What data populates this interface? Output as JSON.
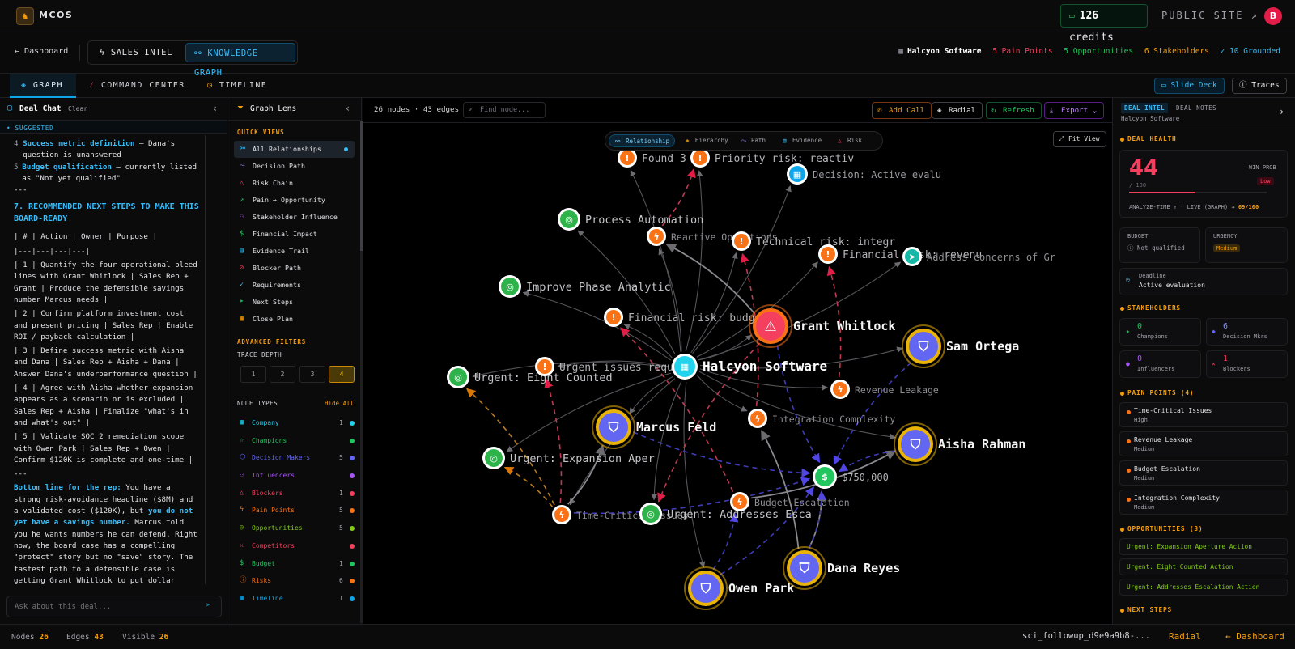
{
  "topbar": {
    "brand": "MCOS",
    "credits_count": "126",
    "credits_label": "credits",
    "public_site": "PUBLIC SITE ↗",
    "avatar": "B"
  },
  "subbar": {
    "back": "Dashboard",
    "mode_sales": "SALES INTEL",
    "mode_kg": "KNOWLEDGE GRAPH",
    "company": "Halcyon Software",
    "pain_points": "5 Pain Points",
    "opportunities": "5 Opportunities",
    "stakeholders": "6 Stakeholders",
    "grounded": "✓ 10 Grounded"
  },
  "tabs": {
    "graph": "GRAPH",
    "command_center": "COMMAND CENTER",
    "timeline": "TIMELINE",
    "slide_deck": "Slide Deck",
    "traces": "Traces"
  },
  "chat": {
    "title": "Deal Chat",
    "clear": "Clear",
    "suggested": "• SUGGESTED",
    "item4_num": "4",
    "item4_bold": "Success metric definition",
    "item4_rest": " — Dana's question is unanswered",
    "item5_num": "5",
    "item5_bold": "Budget qualification",
    "item5_rest": " — currently listed as \"Not yet qualified\"",
    "sep1": "---",
    "section7": "7. RECOMMENDED NEXT STEPS TO MAKE THIS BOARD-READY",
    "table_header": "| # | Action | Owner | Purpose |",
    "table_sep": "|---|---|---|---|",
    "row1": "| 1 | Quantify the four operational bleed lines with Grant Whitlock | Sales Rep + Grant | Produce the defensible savings number Marcus needs |",
    "row2": "| 2 | Confirm platform investment cost and present pricing | Sales Rep | Enable ROI / payback calculation |",
    "row3": "| 3 | Define success metric with Aisha and Dana | Sales Rep + Aisha + Dana | Answer Dana's underperformance question |",
    "row4": "| 4 | Agree with Aisha whether expansion appears as a scenario or is excluded | Sales Rep + Aisha | Finalize \"what's in and what's out\" |",
    "row5": "| 5 | Validate SOC 2 remediation scope with Owen Park | Sales Rep + Owen | Confirm $120K is complete and one-time |",
    "sep2": "---",
    "bottom_bold": "Bottom line for the rep:",
    "bottom_a": " You have a strong risk-avoidance headline ($8M) and a validated cost ($120K), but ",
    "bottom_hl": "you do not yet have a savings number.",
    "bottom_b": " Marcus told you he wants numbers he can defend. Right now, the board case has a compelling \"protect\" story but no \"save\" story. The fastest path to a defensible case is getting Grant Whitlock to put dollar",
    "input_placeholder": "Ask about this deal..."
  },
  "lens": {
    "title": "Graph Lens",
    "quick_views_title": "QUICK VIEWS",
    "quick_views": [
      "All Relationships",
      "Decision Path",
      "Risk Chain",
      "Pain → Opportunity",
      "Stakeholder Influence",
      "Financial Impact",
      "Evidence Trail",
      "Blocker Path",
      "Requirements",
      "Next Steps",
      "Close Plan"
    ],
    "advanced_title": "ADVANCED FILTERS",
    "trace_depth": "TRACE DEPTH",
    "depths": [
      "1",
      "2",
      "3",
      "4"
    ],
    "node_types_title": "NODE TYPES",
    "hide_all": "Hide All",
    "node_types": [
      {
        "label": "Company",
        "count": "1",
        "color": "#22d3ee"
      },
      {
        "label": "Champions",
        "count": "",
        "color": "#22c55e"
      },
      {
        "label": "Decision Makers",
        "count": "5",
        "color": "#6366f1"
      },
      {
        "label": "Influencers",
        "count": "",
        "color": "#a855f7"
      },
      {
        "label": "Blockers",
        "count": "1",
        "color": "#f43f5e"
      },
      {
        "label": "Pain Points",
        "count": "5",
        "color": "#f97316"
      },
      {
        "label": "Opportunities",
        "count": "5",
        "color": "#84cc16"
      },
      {
        "label": "Competitors",
        "count": "",
        "color": "#f43f5e"
      },
      {
        "label": "Budget",
        "count": "1",
        "color": "#22c55e"
      },
      {
        "label": "Risks",
        "count": "6",
        "color": "#f97316"
      },
      {
        "label": "Timeline",
        "count": "1",
        "color": "#0ea5e9"
      }
    ]
  },
  "graph": {
    "stats": "26 nodes · 43 edges",
    "search_placeholder": "Find node...",
    "add_call": "Add Call",
    "radial": "Radial",
    "refresh": "Refresh",
    "export": "Export",
    "lens_tabs": [
      "Relationship",
      "Hierarchy",
      "Path",
      "Evidence",
      "Risk"
    ],
    "fit_view": "Fit View"
  },
  "insights": {
    "tab_intel": "DEAL INTEL",
    "tab_notes": "DEAL NOTES",
    "company": "Halcyon Software",
    "deal_health": "DEAL HEALTH",
    "score": "44",
    "score_max": "/ 100",
    "score_fraction": 0.48,
    "win_prob": "WIN PROB",
    "win_value": "Low",
    "analyze": "ANALYZE-TIME ↑ · LIVE (GRAPH) →",
    "analyze_value": "69/100",
    "budget_label": "BUDGET",
    "budget_value": "Not qualified",
    "urgency_label": "URGENCY",
    "urgency_value": "Medium",
    "deadline_label": "Deadline",
    "deadline_value": "Active evaluation",
    "stakeholders_title": "STAKEHOLDERS",
    "champions_n": "0",
    "champions_l": "Champions",
    "decision_n": "6",
    "decision_l": "Decision Mkrs",
    "influencers_n": "0",
    "influencers_l": "Influencers",
    "blockers_n": "1",
    "blockers_l": "Blockers",
    "pain_points_title": "PAIN POINTS (4)",
    "pain_points": [
      {
        "title": "Time-Critical Issues",
        "level": "High"
      },
      {
        "title": "Revenue Leakage",
        "level": "Medium"
      },
      {
        "title": "Budget Escalation",
        "level": "Medium"
      },
      {
        "title": "Integration Complexity",
        "level": "Medium"
      }
    ],
    "opportunities_title": "OPPORTUNITIES (3)",
    "opportunities": [
      "Urgent: Expansion Aperture Action",
      "Urgent: Eight Counted Action",
      "Urgent: Addresses Escalation Action"
    ],
    "next_steps_title": "NEXT STEPS"
  },
  "status": {
    "nodes_l": "Nodes",
    "nodes_v": "26",
    "edges_l": "Edges",
    "edges_v": "43",
    "visible_l": "Visible",
    "visible_v": "26",
    "trace_id": "sci_followup_d9e9a9b8-...",
    "radial": "Radial",
    "dashboard": "← Dashboard"
  },
  "colors": {
    "accent": "#38bdf8",
    "amber": "#f59e0b",
    "risk": "#f97316",
    "opportunity": "#84cc16",
    "stakeholder": "#6366f1",
    "company": "#22d3ee",
    "budget": "#22c55e",
    "blocker": "#f43f5e",
    "timeline": "#0ea5e9"
  },
  "graph_nodes": [
    {
      "id": "found",
      "type": "risk",
      "label": "Found 3 u"
    },
    {
      "id": "priority",
      "type": "risk",
      "label": "Priority risk: reactiv"
    },
    {
      "id": "decision",
      "type": "timeline",
      "label": "Decision: Active evalu"
    },
    {
      "id": "process",
      "type": "opportunity",
      "label": "Process Automation"
    },
    {
      "id": "reactive",
      "type": "pain",
      "label": "Reactive Operations"
    },
    {
      "id": "technical",
      "type": "risk",
      "label": "Technical risk: integr"
    },
    {
      "id": "financial1",
      "type": "risk",
      "label": "Financial risk: revenu"
    },
    {
      "id": "address",
      "type": "next",
      "label": "Address concerns of Gr"
    },
    {
      "id": "improve",
      "type": "opportunity",
      "label": "Improve Phase Analytic"
    },
    {
      "id": "financial2",
      "type": "risk",
      "label": "Financial risk: budget"
    },
    {
      "id": "grant",
      "type": "blocker",
      "label": "Grant Whitlock"
    },
    {
      "id": "sam",
      "type": "stakeholder",
      "label": "Sam Ortega"
    },
    {
      "id": "urgent_eight",
      "type": "opportunity",
      "label": "Urgent: Eight Counted"
    },
    {
      "id": "urgent_issues",
      "type": "risk",
      "label": "Urgent issues require"
    },
    {
      "id": "halcyon",
      "type": "company",
      "label": "Halcyon Software"
    },
    {
      "id": "revenue",
      "type": "pain",
      "label": "Revenue Leakage"
    },
    {
      "id": "marcus",
      "type": "stakeholder",
      "label": "Marcus Feld"
    },
    {
      "id": "integration",
      "type": "pain",
      "label": "Integration Complexity"
    },
    {
      "id": "aisha",
      "type": "stakeholder",
      "label": "Aisha Rahman"
    },
    {
      "id": "expansion",
      "type": "opportunity",
      "label": "Urgent: Expansion Aper"
    },
    {
      "id": "budget",
      "type": "budget",
      "label": "$750,000"
    },
    {
      "id": "time",
      "type": "pain",
      "label": "Time-Critical Issues"
    },
    {
      "id": "addresses",
      "type": "opportunity",
      "label": "Urgent: Addresses Esca"
    },
    {
      "id": "budgetesc",
      "type": "pain",
      "label": "Budget Escalation"
    },
    {
      "id": "dana",
      "type": "stakeholder",
      "label": "Dana Reyes"
    },
    {
      "id": "owen",
      "type": "stakeholder",
      "label": "Owen Park"
    }
  ],
  "graph_edges": [
    [
      "halcyon",
      "process",
      "solid"
    ],
    [
      "halcyon",
      "improve",
      "solid"
    ],
    [
      "halcyon",
      "reactive",
      "solid"
    ],
    [
      "halcyon",
      "found",
      "solid"
    ],
    [
      "halcyon",
      "priority",
      "solid"
    ],
    [
      "halcyon",
      "decision",
      "solid"
    ],
    [
      "halcyon",
      "technical",
      "solid"
    ],
    [
      "halcyon",
      "financial1",
      "solid"
    ],
    [
      "halcyon",
      "address",
      "solid"
    ],
    [
      "halcyon",
      "financial2",
      "solid"
    ],
    [
      "halcyon",
      "grant",
      "solid"
    ],
    [
      "halcyon",
      "sam",
      "solid"
    ],
    [
      "halcyon",
      "urgent_eight",
      "solid"
    ],
    [
      "halcyon",
      "urgent_issues",
      "solid"
    ],
    [
      "halcyon",
      "revenue",
      "solid"
    ],
    [
      "halcyon",
      "marcus",
      "solid"
    ],
    [
      "halcyon",
      "integration",
      "solid"
    ],
    [
      "halcyon",
      "aisha",
      "solid"
    ],
    [
      "halcyon",
      "expansion",
      "solid"
    ],
    [
      "halcyon",
      "time",
      "solid"
    ],
    [
      "halcyon",
      "addresses",
      "solid"
    ],
    [
      "halcyon",
      "owen",
      "solid"
    ],
    [
      "grant",
      "reactive",
      "solid"
    ],
    [
      "time",
      "marcus",
      "solid"
    ],
    [
      "budgetesc",
      "aisha",
      "solid"
    ],
    [
      "dana",
      "integration",
      "solid"
    ],
    [
      "dana",
      "budget",
      "solid"
    ],
    [
      "reactive",
      "priority",
      "red"
    ],
    [
      "integration",
      "technical",
      "red"
    ],
    [
      "revenue",
      "financial1",
      "red"
    ],
    [
      "budgetesc",
      "financial2",
      "red"
    ],
    [
      "time",
      "urgent_issues",
      "red"
    ],
    [
      "grant",
      "addresses",
      "red"
    ],
    [
      "time",
      "urgent_eight",
      "orange"
    ],
    [
      "time",
      "expansion",
      "orange"
    ],
    [
      "grant",
      "budget",
      "blue"
    ],
    [
      "marcus",
      "budget",
      "blue"
    ],
    [
      "sam",
      "budget",
      "blue"
    ],
    [
      "aisha",
      "budget",
      "blue"
    ],
    [
      "owen",
      "budget",
      "blue"
    ],
    [
      "dana",
      "budget",
      "blue"
    ],
    [
      "owen",
      "budgetesc",
      "blue"
    ],
    [
      "time",
      "budget",
      "blue"
    ]
  ]
}
